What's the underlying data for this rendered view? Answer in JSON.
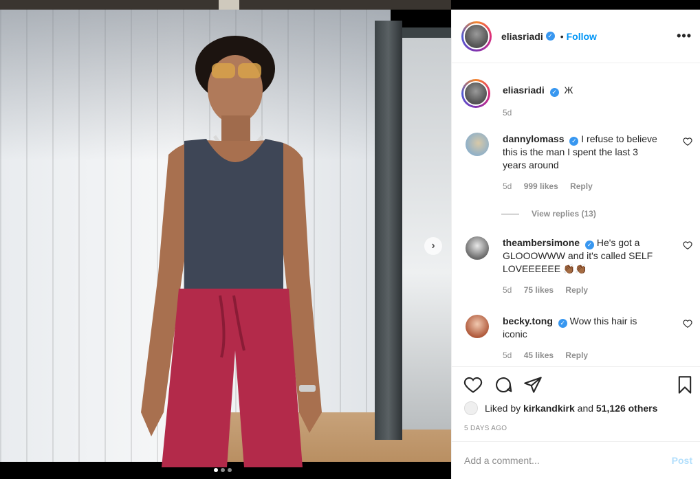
{
  "post": {
    "author": "eliasriadi",
    "follow_label": "Follow",
    "bullet": "•",
    "more_label": "•••",
    "caption": "Ж",
    "caption_age": "5d",
    "liked_by_prefix": "Liked by",
    "liked_by_user": "kirkandkirk",
    "liked_and": "and",
    "liked_others": "51,126 others",
    "posted_date": "5 DAYS AGO"
  },
  "comments": [
    {
      "username": "dannylomass",
      "text": "I refuse to believe this is the man I spent the last 3 years around",
      "age": "5d",
      "likes": "999 likes",
      "reply": "Reply",
      "view_replies": "View replies (13)"
    },
    {
      "username": "theambersimone",
      "text": "He's got a GLOOOWWW and it's called SELF LOVEEEEEE 👏🏾👏🏾",
      "age": "5d",
      "likes": "75 likes",
      "reply": "Reply"
    },
    {
      "username": "becky.tong",
      "text": "Wow this hair is iconic",
      "age": "5d",
      "likes": "45 likes",
      "reply": "Reply"
    }
  ],
  "composer": {
    "placeholder": "Add a comment...",
    "post_label": "Post"
  },
  "carousel": {
    "next_label": "›"
  },
  "colors": {
    "accent": "#0095f6",
    "verified": "#3897f0",
    "post_disabled": "#b2dffc"
  }
}
